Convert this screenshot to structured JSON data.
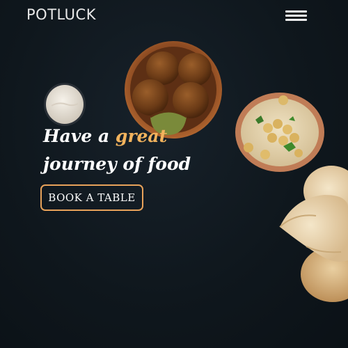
{
  "header": {
    "brand": "POTLUCK",
    "menu_icon": "hamburger-menu-icon"
  },
  "hero": {
    "headline_part1": "Have a ",
    "headline_accent": "great",
    "headline_line2": "journey of food",
    "cta_label": "BOOK A TABLE",
    "images": [
      "falafel-bowl",
      "yogurt-dip-bowl",
      "hummus-bowl",
      "pita-bread"
    ]
  },
  "colors": {
    "background": "#0f171d",
    "accent": "#f2b35d",
    "button_border": "#e8a25a",
    "text": "#ffffff"
  }
}
